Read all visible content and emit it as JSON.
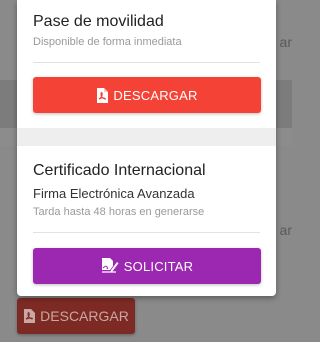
{
  "background": {
    "side_text_1": "ar",
    "side_text_2": "ar",
    "download_button": "DESCARGAR"
  },
  "mobility": {
    "title": "Pase de movilidad",
    "caption": "Disponible de forma inmediata",
    "download_label": "DESCARGAR"
  },
  "certificate": {
    "title": "Certificado Internacional",
    "subtitle": "Firma Electrónica Avanzada",
    "caption": "Tarda hasta 48 horas en generarse",
    "request_label": "SOLICITAR"
  },
  "colors": {
    "download": "#f44336",
    "request": "#9c27b0"
  },
  "icons": {
    "download": "pdf-file-icon",
    "request": "signature-pen-icon"
  }
}
